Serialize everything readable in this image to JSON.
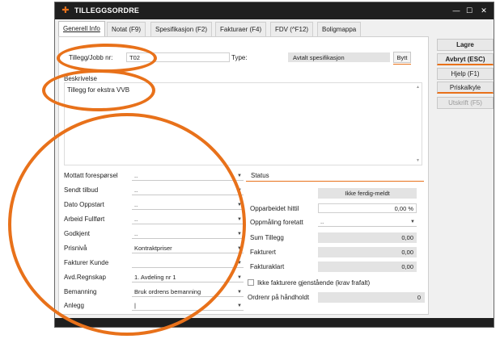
{
  "window": {
    "title": "TILLEGGSORDRE",
    "controls": {
      "minimize": "—",
      "maximize": "☐",
      "close": "✕"
    }
  },
  "tabs": [
    {
      "label": "Generell Info",
      "active": true
    },
    {
      "label": "Notat (F9)"
    },
    {
      "label": "Spesifikasjon (F2)"
    },
    {
      "label": "Fakturaer (F4)"
    },
    {
      "label": "FDV (^F12)"
    },
    {
      "label": "Boligmappa"
    }
  ],
  "header": {
    "jobb_label": "Tillegg/Jobb nr:",
    "jobb_value": "T02",
    "type_label": "Type:",
    "type_value": "Avtalt spesifikasjon",
    "bytt_button": "Bytt"
  },
  "beskrivelse": {
    "label": "Beskrivelse",
    "text": "Tillegg for ekstra VVB"
  },
  "left_fields": [
    {
      "label": "Mottatt forespørsel",
      "value": ".."
    },
    {
      "label": "Sendt tilbud",
      "value": ".."
    },
    {
      "label": "Dato Oppstart",
      "value": ".."
    },
    {
      "label": "Arbeid Fullført",
      "value": ".."
    },
    {
      "label": "Godkjent",
      "value": ".."
    },
    {
      "label": "Prisnivå",
      "value": "Kontraktpriser"
    },
    {
      "label": "Fakturer Kunde",
      "value": ""
    },
    {
      "label": "Avd.Regnskap",
      "value": "1.  Avdeling nr 1"
    },
    {
      "label": "Bemanning",
      "value": "Bruk ordrens bemanning"
    },
    {
      "label": "Anlegg",
      "value": "|"
    }
  ],
  "status": {
    "title": "Status",
    "state": "Ikke ferdig-meldt",
    "rows": [
      {
        "label": "Opparbeidet hittil",
        "value": "0,00 %"
      },
      {
        "label": "Oppmåling foretatt",
        "value": ".."
      },
      {
        "label": "Sum Tillegg",
        "value": "0,00"
      },
      {
        "label": "Fakturert",
        "value": "0,00"
      },
      {
        "label": "Fakturaklart",
        "value": "0,00"
      }
    ],
    "checkbox_label": "Ikke fakturere gjenstående (krav frafalt)",
    "handholdt_label": "Ordrenr på håndholdt",
    "handholdt_value": "0"
  },
  "side_buttons": {
    "lagre": "Lagre",
    "avbryt": "Avbryt (ESC)",
    "hjelp": "Hjelp (F1)",
    "priskalkyle": "Priskalkyle",
    "utskrift": "Utskrift (F5)"
  },
  "colors": {
    "accent": "#e8711a",
    "titlebar": "#1f1f1f"
  }
}
